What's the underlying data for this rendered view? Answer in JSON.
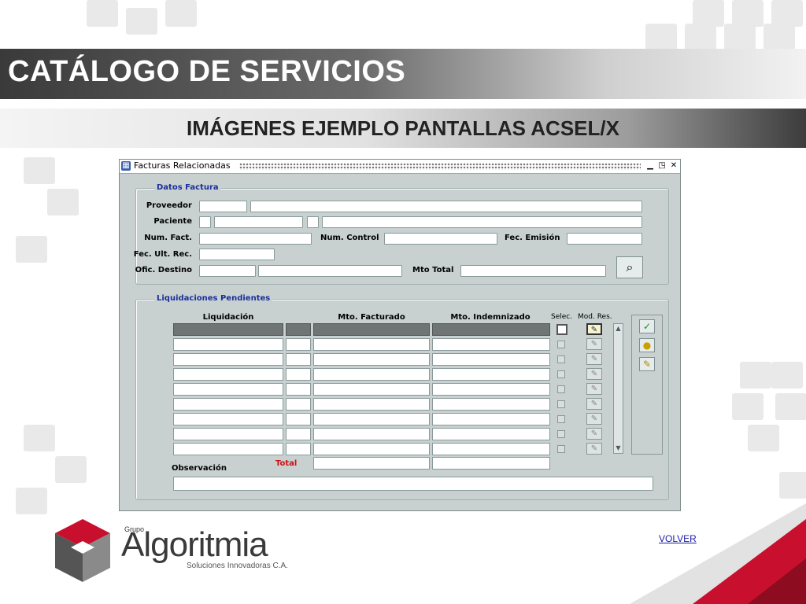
{
  "slide": {
    "title": "CATÁLOGO DE SERVICIOS",
    "subtitle": "IMÁGENES EJEMPLO PANTALLAS ACSEL/X",
    "volver": "VOLVER"
  },
  "logo": {
    "grupo": "Grupo",
    "name": "Algoritmia",
    "tagline": "Soluciones Innovadoras C.A."
  },
  "window": {
    "title": "Facturas Relacionadas",
    "datos_factura": {
      "label": "Datos Factura",
      "proveedor": "Proveedor",
      "paciente": "Paciente",
      "num_fact": "Num. Fact.",
      "num_control": "Num. Control",
      "fec_emision": "Fec. Emisión",
      "fec_ult_rec": "Fec. Ult. Rec.",
      "ofic_destino": "Ofic. Destino",
      "mto_total": "Mto Total"
    },
    "liquidaciones": {
      "label": "Liquidaciones Pendientes",
      "col_liquidacion": "Liquidación",
      "col_mto_facturado": "Mto. Facturado",
      "col_mto_indemnizado": "Mto. Indemnizado",
      "col_selec": "Selec.",
      "col_mod_res": "Mod. Res.",
      "total": "Total",
      "observacion": "Observación",
      "row_count": 9
    }
  },
  "colors": {
    "window_bg": "#c8d0d0",
    "group_label": "#1a2f9a",
    "total_label": "#d01010",
    "link": "#1a1aa8"
  },
  "icons": {
    "window_app": "window-app-icon",
    "minimize": "minimize-icon",
    "maximize": "maximize-icon",
    "close": "close-icon",
    "search": "binoculars-icon",
    "accept": "checkmark-icon",
    "circle": "circle-icon",
    "pin": "pin-icon"
  }
}
